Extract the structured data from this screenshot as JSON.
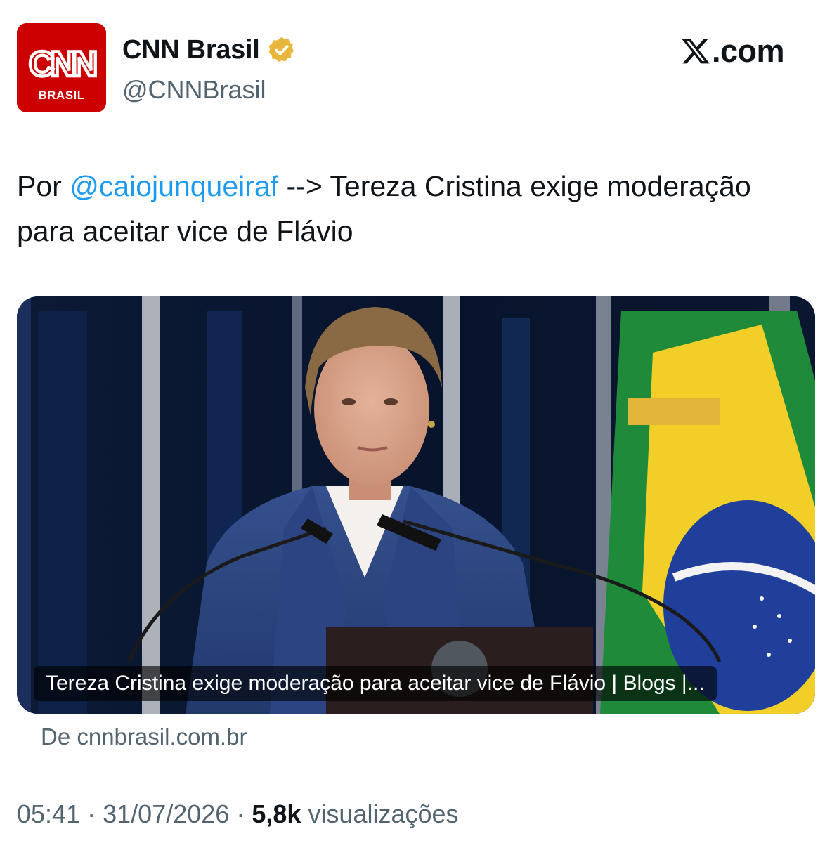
{
  "author": {
    "avatar_logo_text": "CNN",
    "avatar_sub_text": "BRASIL",
    "display_name": "CNN Brasil",
    "handle": "@CNNBrasil",
    "verified_badge_color": "#e8b63a"
  },
  "brand": {
    "site": ".com",
    "icon": "x-logo-icon"
  },
  "tweet": {
    "prefix": "Por ",
    "mention": "@caiojunqueiraf",
    "text_after_mention": " --> Tereza Cristina exige moderação para aceitar vice de Flávio",
    "mention_color": "#1d9bf0"
  },
  "card": {
    "caption": "Tereza Cristina exige moderação para aceitar vice de Flávio | Blogs |...",
    "source": "De cnnbrasil.com.br"
  },
  "meta": {
    "time": "05:41",
    "separator": "·",
    "date": "31/07/2026",
    "views_count": "5,8k",
    "views_label": "visualizações"
  },
  "colors": {
    "text_primary": "#0f1419",
    "text_secondary": "#536471",
    "cnn_red": "#cc0000"
  }
}
